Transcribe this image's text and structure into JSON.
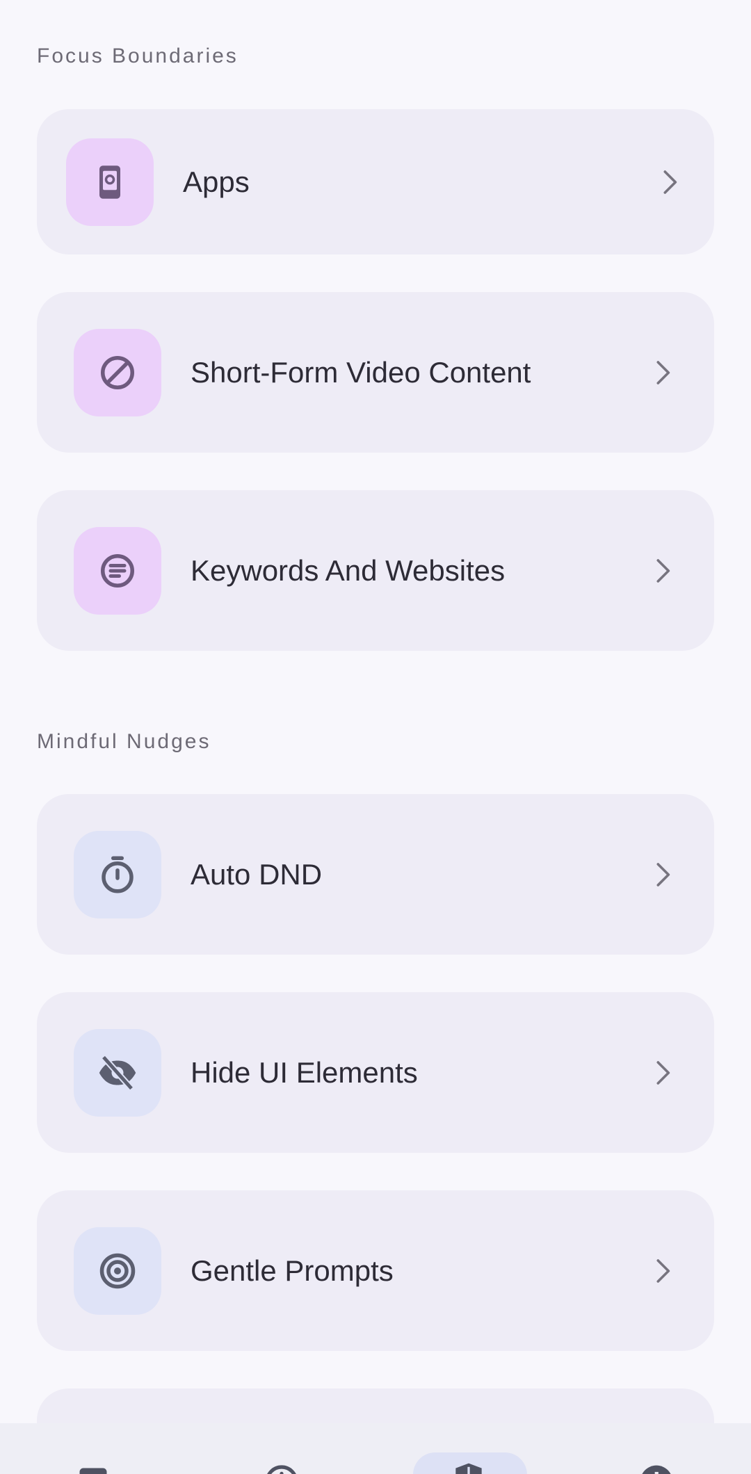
{
  "sections": [
    {
      "title": "Focus Boundaries",
      "items": [
        {
          "label": "Apps",
          "icon": "phone-icon",
          "tone": "purple"
        },
        {
          "label": "Short-Form Video Content",
          "icon": "block-icon",
          "tone": "purple"
        },
        {
          "label": "Keywords And Websites",
          "icon": "text-circle-icon",
          "tone": "purple"
        }
      ]
    },
    {
      "title": "Mindful Nudges",
      "items": [
        {
          "label": "Auto DND",
          "icon": "timer-icon",
          "tone": "blue"
        },
        {
          "label": "Hide UI Elements",
          "icon": "eye-off-icon",
          "tone": "blue"
        },
        {
          "label": "Gentle Prompts",
          "icon": "target-icon",
          "tone": "blue"
        }
      ]
    }
  ],
  "bottom_nav": {
    "items": [
      {
        "icon": "dashboard-icon",
        "active": false
      },
      {
        "icon": "clock-icon",
        "active": false
      },
      {
        "icon": "shield-icon",
        "active": true
      },
      {
        "icon": "info-icon",
        "active": false
      }
    ]
  },
  "colors": {
    "background": "#f8f7fc",
    "card": "#eeecf6",
    "purple_tile": "#ebd0fa",
    "blue_tile": "#dfe3f7",
    "icon_purple": "#6e5a7e",
    "icon_blue": "#5c5f70",
    "chevron": "#77747f"
  }
}
